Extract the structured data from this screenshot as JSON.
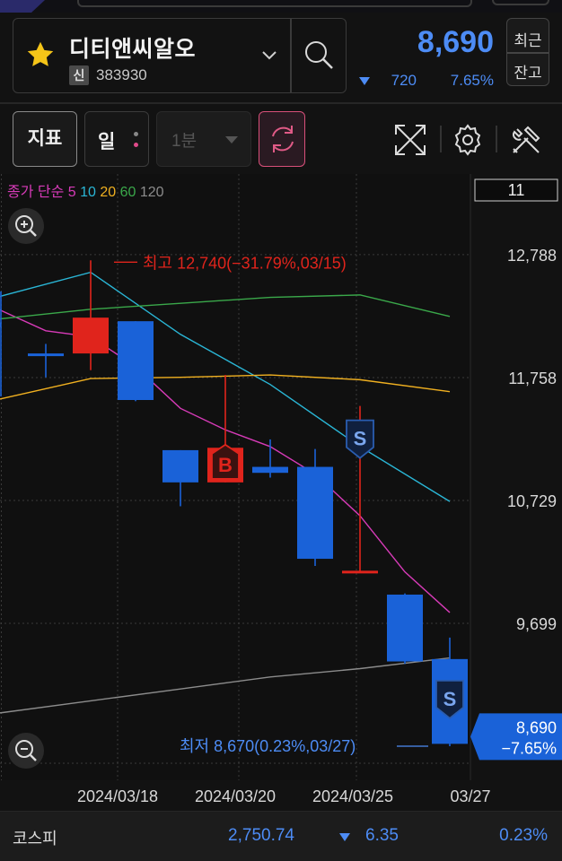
{
  "stock": {
    "name": "디티앤씨알오",
    "badge": "신",
    "code": "383930",
    "price": "8,690",
    "change": "720",
    "change_pct": "7.65%",
    "direction": "down",
    "recent_label": "최근",
    "balance_label": "잔고"
  },
  "toolbar": {
    "indicator_label": "지표",
    "period_label": "일",
    "interval_label": "1분",
    "icons": [
      "refresh-icon",
      "fullscreen-icon",
      "gear-icon",
      "tools-icon"
    ]
  },
  "colors": {
    "up": "#e0241c",
    "down": "#1a62d8",
    "ma5": "#d73bb8",
    "ma10": "#2ab6d6",
    "ma20": "#f0b020",
    "ma60": "#3aa84a",
    "ma120": "#8c8c8c",
    "accent_blue": "#4d8cf5"
  },
  "chart": {
    "legend": {
      "prefix": "종가 단순",
      "periods": [
        "5",
        "10",
        "20",
        "60",
        "120"
      ]
    },
    "visible_count": "11",
    "y_ticks": [
      "12,788",
      "11,758",
      "10,729",
      "9,699"
    ],
    "x_ticks": [
      "2024/03/18",
      "2024/03/20",
      "2024/03/25",
      "03/27"
    ],
    "high_label": "최고 12,740(−31.79%,03/15)",
    "low_label": "최저 8,670(0.23%,03/27)",
    "current_price": "8,690",
    "current_pct": "−7.65%",
    "markers": [
      {
        "type": "B",
        "candle": 5
      },
      {
        "type": "S",
        "candle": 8
      },
      {
        "type": "S",
        "candle": 10
      }
    ]
  },
  "chart_data": {
    "type": "candlestick",
    "ylim": [
      8550,
      13050
    ],
    "y_ticks": [
      12788,
      11758,
      10729,
      9699
    ],
    "candles": [
      {
        "o": 12220,
        "h": 12480,
        "l": 11600,
        "c": 12180
      },
      {
        "o": 11960,
        "h": 12040,
        "l": 11760,
        "c": 11940
      },
      {
        "o": 11960,
        "h": 12740,
        "l": 11820,
        "c": 12260
      },
      {
        "o": 12230,
        "h": 12230,
        "l": 11560,
        "c": 11570
      },
      {
        "o": 11150,
        "h": 11150,
        "l": 10680,
        "c": 10880
      },
      {
        "o": 10880,
        "h": 11780,
        "l": 10880,
        "c": 11170
      },
      {
        "o": 11010,
        "h": 11240,
        "l": 10920,
        "c": 10960
      },
      {
        "o": 11010,
        "h": 11160,
        "l": 10180,
        "c": 10240
      },
      {
        "o": 10130,
        "h": 11520,
        "l": 10130,
        "c": 10140
      },
      {
        "o": 9940,
        "h": 9950,
        "l": 9360,
        "c": 9380
      },
      {
        "o": 9400,
        "h": 9580,
        "l": 8670,
        "c": 8690
      }
    ],
    "ma_series": [
      {
        "name": "5",
        "points": [
          [
            -2,
            12690
          ],
          [
            0,
            12320
          ],
          [
            1,
            12150
          ],
          [
            2,
            12100
          ],
          [
            3,
            11850
          ],
          [
            4,
            11500
          ],
          [
            5,
            11320
          ],
          [
            6,
            11180
          ],
          [
            7,
            10950
          ],
          [
            8,
            10600
          ],
          [
            9,
            10130
          ],
          [
            10,
            9790
          ]
        ]
      },
      {
        "name": "10",
        "points": [
          [
            -2,
            12150
          ],
          [
            0,
            12440
          ],
          [
            2,
            12640
          ],
          [
            4,
            12120
          ],
          [
            6,
            11700
          ],
          [
            8,
            11180
          ],
          [
            10,
            10720
          ]
        ]
      },
      {
        "name": "20",
        "points": [
          [
            -2,
            11370
          ],
          [
            0,
            11580
          ],
          [
            2,
            11750
          ],
          [
            4,
            11760
          ],
          [
            6,
            11780
          ],
          [
            8,
            11740
          ],
          [
            10,
            11640
          ]
        ]
      },
      {
        "name": "60",
        "points": [
          [
            -2,
            12200
          ],
          [
            0,
            12250
          ],
          [
            2,
            12330
          ],
          [
            4,
            12380
          ],
          [
            6,
            12430
          ],
          [
            8,
            12450
          ],
          [
            10,
            12270
          ]
        ]
      },
      {
        "name": "120",
        "points": [
          [
            -2,
            8850
          ],
          [
            0,
            8950
          ],
          [
            2,
            9050
          ],
          [
            4,
            9150
          ],
          [
            6,
            9250
          ],
          [
            8,
            9320
          ],
          [
            10,
            9410
          ]
        ]
      }
    ]
  },
  "index": {
    "name": "코스피",
    "value": "2,750.74",
    "change": "6.35",
    "change_pct": "0.23%"
  }
}
